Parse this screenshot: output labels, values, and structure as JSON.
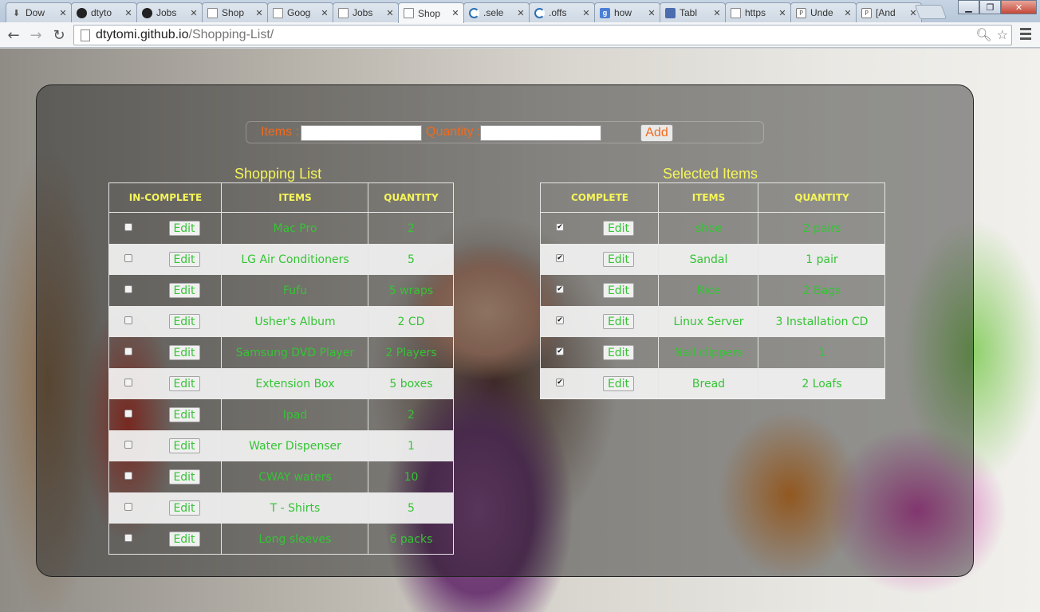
{
  "browser": {
    "tabs": [
      {
        "label": "Dow",
        "icon": "download-icon"
      },
      {
        "label": "dtyto",
        "icon": "github-icon"
      },
      {
        "label": "Jobs",
        "icon": "github-icon"
      },
      {
        "label": "Shop",
        "icon": "page-icon"
      },
      {
        "label": "Goog",
        "icon": "page-icon"
      },
      {
        "label": "Jobs",
        "icon": "page-icon"
      },
      {
        "label": "Shop",
        "icon": "page-icon",
        "active": true
      },
      {
        "label": ".sele",
        "icon": "jquery-icon"
      },
      {
        "label": ".offs",
        "icon": "jquery-icon"
      },
      {
        "label": "how",
        "icon": "google-icon"
      },
      {
        "label": "Tabl",
        "icon": "facebook-icon"
      },
      {
        "label": "https",
        "icon": "page-icon"
      },
      {
        "label": "Unde",
        "icon": "p-icon"
      },
      {
        "label": "[And",
        "icon": "p-icon"
      }
    ],
    "url_host": "dtytomi.github.io",
    "url_path": "/Shopping-List/"
  },
  "form": {
    "items_label": "Items :",
    "quantity_label": "Quantity :",
    "items_value": "",
    "quantity_value": "",
    "add_label": "Add"
  },
  "shopping_list": {
    "title": "Shopping List",
    "headers": [
      "IN-COMPLETE",
      "ITEMS",
      "QUANTITY"
    ],
    "edit_label": "Edit",
    "rows": [
      {
        "item": "Mac Pro",
        "qty": "2",
        "checked": false
      },
      {
        "item": "LG Air Conditioners",
        "qty": "5",
        "checked": false
      },
      {
        "item": "Fufu",
        "qty": "5 wraps",
        "checked": false
      },
      {
        "item": "Usher's Album",
        "qty": "2 CD",
        "checked": false
      },
      {
        "item": "Samsung DVD Player",
        "qty": "2 Players",
        "checked": false
      },
      {
        "item": "Extension Box",
        "qty": "5 boxes",
        "checked": false
      },
      {
        "item": "Ipad",
        "qty": "2",
        "checked": false
      },
      {
        "item": "Water Dispenser",
        "qty": "1",
        "checked": false
      },
      {
        "item": "CWAY waters",
        "qty": "10",
        "checked": false
      },
      {
        "item": "T - Shirts",
        "qty": "5",
        "checked": false
      },
      {
        "item": "Long sleeves",
        "qty": "6 packs",
        "checked": false
      }
    ]
  },
  "selected_items": {
    "title": "Selected Items",
    "headers": [
      "COMPLETE",
      "ITEMS",
      "QUANTITY"
    ],
    "edit_label": "Edit",
    "rows": [
      {
        "item": "shoe",
        "qty": "2 pairs",
        "checked": true
      },
      {
        "item": "Sandal",
        "qty": "1 pair",
        "checked": true
      },
      {
        "item": "Rice",
        "qty": "2 Bags",
        "checked": true
      },
      {
        "item": "Linux Server",
        "qty": "3 Installation CD",
        "checked": true
      },
      {
        "item": "Nail clippers",
        "qty": "1",
        "checked": true
      },
      {
        "item": "Bread",
        "qty": "2 Loafs",
        "checked": true
      }
    ]
  },
  "colors": {
    "header_text": "#f5f55a",
    "cell_text": "#35c435",
    "form_label": "#f26a1b"
  }
}
